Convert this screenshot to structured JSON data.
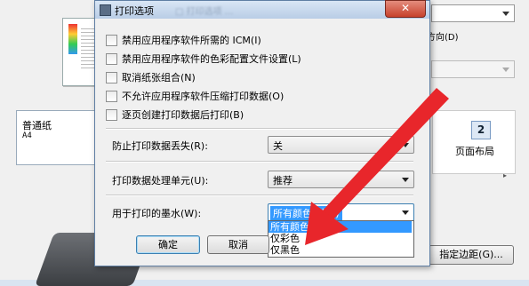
{
  "background": {
    "paper_type": "普通纸",
    "paper_size": "A4",
    "orientation_label": "方向(D)",
    "layout_icon_number": "2",
    "layout_label": "页面布局",
    "margin_button": "指定边距(G)...",
    "small_arrow": "▸"
  },
  "dialog": {
    "title": "打印选项",
    "title_blurred": "□ 打印选项 ...",
    "close": "✕",
    "checkboxes": [
      {
        "label": "禁用应用程序软件所需的 ICM(I)",
        "checked": false
      },
      {
        "label": "禁用应用程序软件的色彩配置文件设置(L)",
        "checked": false
      },
      {
        "label": "取消纸张组合(N)",
        "checked": false
      },
      {
        "label": "不允许应用程序软件压缩打印数据(O)",
        "checked": false
      },
      {
        "label": "逐页创建打印数据后打印(B)",
        "checked": false
      }
    ],
    "fields": {
      "prevent_loss": {
        "label": "防止打印数据丢失(R):",
        "value": "关"
      },
      "data_unit": {
        "label": "打印数据处理单元(U):",
        "value": "推荐"
      },
      "ink": {
        "label": "用于打印的墨水(W):",
        "value": "所有颜色(默认)"
      }
    },
    "ink_options": [
      "所有颜色(默认)",
      "仅彩色",
      "仅黑色"
    ],
    "buttons": {
      "ok": "确定",
      "cancel": "取消"
    }
  },
  "colors": {
    "selection": "#3399ff",
    "arrow": "#e8262b"
  }
}
